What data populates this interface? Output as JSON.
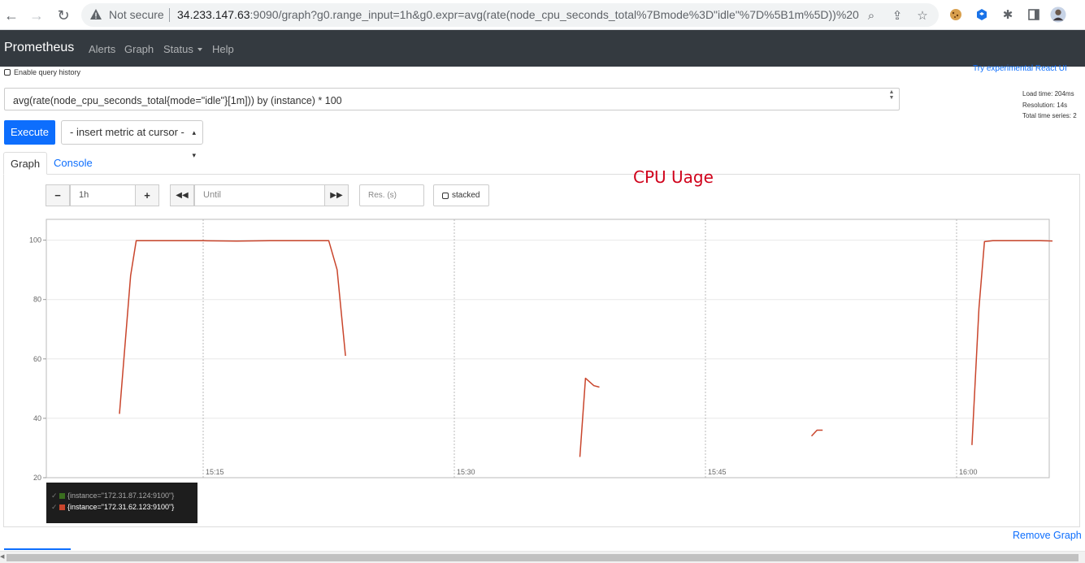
{
  "browser": {
    "security_label": "Not secure",
    "url_host": "34.233.147.63",
    "url_rest": ":9090/graph?g0.range_input=1h&g0.expr=avg(rate(node_cpu_seconds_total%7Bmode%3D\"idle\"%7D%5B1m%5D))%20..."
  },
  "navbar": {
    "brand": "Prometheus",
    "alerts": "Alerts",
    "graph": "Graph",
    "status": "Status",
    "help": "Help"
  },
  "query": {
    "history_label": "Enable query history",
    "react_link": "Try experimental React UI",
    "expression": "avg(rate(node_cpu_seconds_total{mode=\"idle\"}[1m])) by (instance) * 100",
    "execute_label": "Execute",
    "insert_metric_label": "- insert metric at cursor -",
    "stats": {
      "load_time": "Load time: 204ms",
      "resolution": "Resolution: 14s",
      "total_series": "Total time series: 2"
    }
  },
  "tabs": {
    "graph": "Graph",
    "console": "Console"
  },
  "annotation": "CPU Uage",
  "controls": {
    "range_value": "1h",
    "minus": "−",
    "plus": "+",
    "until_placeholder": "Until",
    "res_placeholder": "Res. (s)",
    "stacked_label": "stacked"
  },
  "chart_data": {
    "type": "line",
    "ylim": [
      20,
      107
    ],
    "yticks": [
      20,
      40,
      60,
      80,
      100
    ],
    "xticks": [
      "15:15",
      "15:30",
      "15:45",
      "16:00"
    ],
    "grid": true,
    "legend_position": "bottom-left",
    "series": [
      {
        "name": "{instance=\"172.31.87.124:9100\"}",
        "color": "#3a6e1f",
        "segments": []
      },
      {
        "name": "{instance=\"172.31.62.123:9100\"}",
        "color": "#c9452c",
        "segments": [
          [
            [
              "15:10:00",
              41.5
            ],
            [
              "15:10:40",
              88
            ],
            [
              "15:11:00",
              99.8
            ],
            [
              "15:13:00",
              99.8
            ],
            [
              "15:15:00",
              99.8
            ],
            [
              "15:17:00",
              99.7
            ],
            [
              "15:19:00",
              99.8
            ],
            [
              "15:21:00",
              99.8
            ],
            [
              "15:22:30",
              99.8
            ],
            [
              "15:23:00",
              90
            ],
            [
              "15:23:30",
              61
            ]
          ],
          [
            [
              "15:37:30",
              27
            ],
            [
              "15:37:50",
              53.5
            ],
            [
              "15:38:20",
              51
            ],
            [
              "15:38:40",
              50.5
            ]
          ],
          [
            [
              "15:51:20",
              34
            ],
            [
              "15:51:40",
              36
            ],
            [
              "15:52:00",
              36
            ]
          ],
          [
            [
              "16:00:55",
              31
            ],
            [
              "16:01:20",
              77
            ],
            [
              "16:01:40",
              99.5
            ],
            [
              "16:02:10",
              99.8
            ],
            [
              "16:05:00",
              99.8
            ],
            [
              "16:06:00",
              99.7
            ]
          ]
        ]
      }
    ]
  },
  "remove_graph": "Remove Graph"
}
